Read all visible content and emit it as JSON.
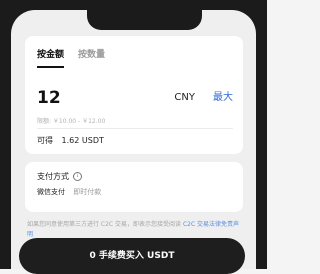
{
  "tabs": [
    {
      "label": "按金额",
      "active": true
    },
    {
      "label": "按数量",
      "active": false
    }
  ],
  "amount": {
    "value": "12",
    "currency": "CNY",
    "max_label": "最大",
    "limit_text": "限额: ￥10.00 - ￥12.00"
  },
  "available": {
    "label": "可得",
    "value": "1.62 USDT"
  },
  "payment": {
    "title": "支付方式",
    "method": "微信支付",
    "speed": "即时付款"
  },
  "disclaimer": {
    "text": "如果您同意使用第三方进行 C2C 交易，即表示您接受阅读",
    "link_text": "C2C 交易法律免责声明"
  },
  "buy_button": {
    "label": "0 手续费买入 USDT"
  },
  "colors": {
    "accent": "#2f6bd8",
    "button_bg": "#1e1e1e",
    "frame": "#1b1b1b"
  }
}
